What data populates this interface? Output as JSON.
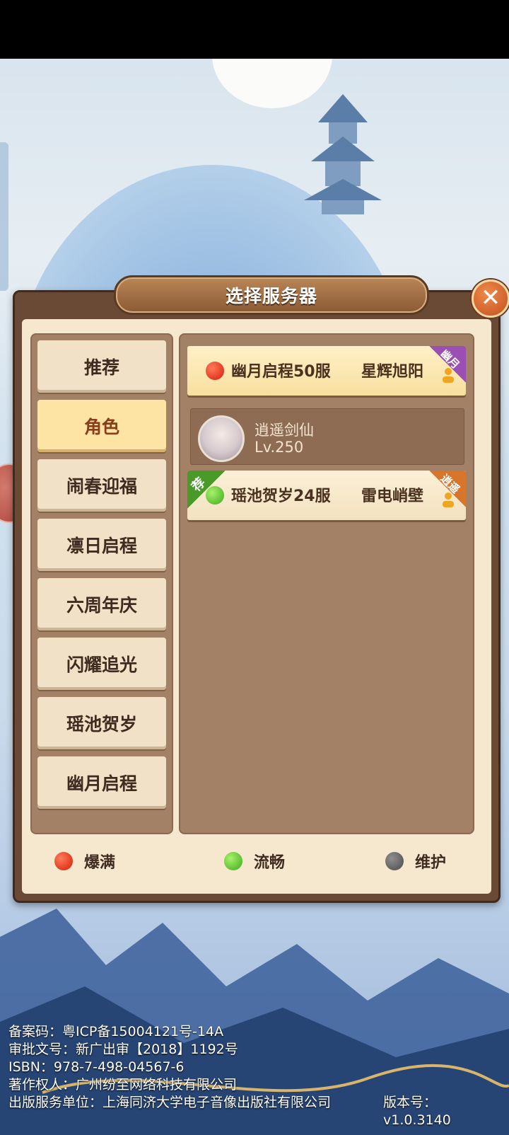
{
  "dialog": {
    "title": "选择服务器",
    "close_label": "✕"
  },
  "categories": [
    {
      "label": "推荐",
      "active": false
    },
    {
      "label": "角色",
      "active": true
    },
    {
      "label": "闹春迎福",
      "active": false
    },
    {
      "label": "凛日启程",
      "active": false
    },
    {
      "label": "六周年庆",
      "active": false
    },
    {
      "label": "闪耀追光",
      "active": false
    },
    {
      "label": "瑶池贺岁",
      "active": false
    },
    {
      "label": "幽月启程",
      "active": false
    }
  ],
  "servers": [
    {
      "status": "red",
      "name": "幽月启程50服",
      "role": "星辉旭阳",
      "corner": "幽月",
      "corner_color": "#9b4fb4",
      "recommended": false
    },
    {
      "status": "green",
      "name": "瑶池贺岁24服",
      "role": "雷电峭壁",
      "corner": "逍遥",
      "corner_color": "#d7752b",
      "recommended": true,
      "recommended_label": "荐"
    }
  ],
  "character": {
    "name": "逍遥剑仙",
    "level": "Lv.250"
  },
  "legend": [
    {
      "status": "red",
      "label": "爆满"
    },
    {
      "status": "green",
      "label": "流畅"
    },
    {
      "status": "gray",
      "label": "维护"
    }
  ],
  "footer": {
    "line1": "备案码：粤ICP备15004121号-14A",
    "line2": "审批文号：新广出审【2018】1192号",
    "line3": "ISBN：978-7-498-04567-6",
    "line4": "著作权人：广州纷至网络科技有限公司",
    "line5": "出版服务单位：上海同济大学电子音像出版社有限公司",
    "version": "版本号：v1.0.3140"
  }
}
